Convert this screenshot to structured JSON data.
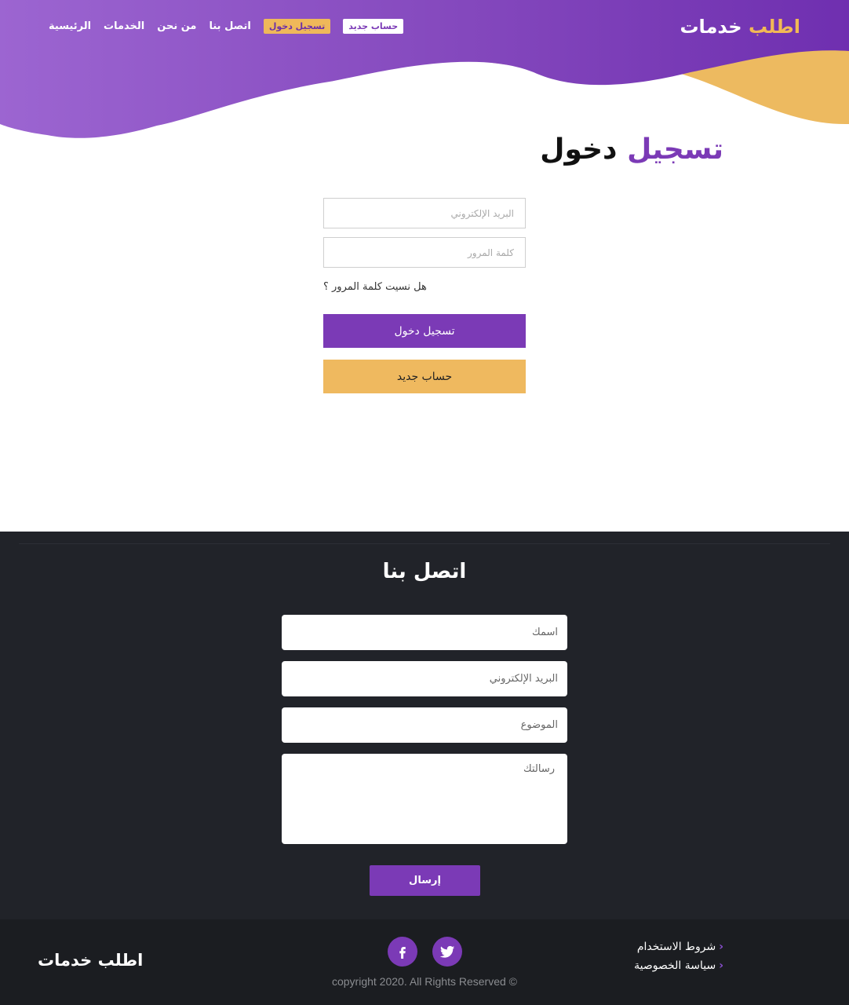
{
  "header": {
    "brand": {
      "part1": "اطلب",
      "part2": "خدمات"
    },
    "nav": {
      "home": "الرئيسية",
      "services": "الخدمات",
      "about": "من نحن",
      "contact": "اتصل بنا",
      "login": "تسجيل دخول",
      "register": "حساب جديد"
    }
  },
  "login": {
    "title_accent": "تسجيل",
    "title_rest": "دخول",
    "email_placeholder": "البريد الإلكتروني",
    "password_placeholder": "كلمة المرور",
    "forgot": "هل نسيت كلمة المرور ؟",
    "submit": "تسجيل دخول",
    "register": "حساب جديد"
  },
  "contact": {
    "title": "اتصل بنا",
    "name_placeholder": "اسمك",
    "email_placeholder": "البريد الإلكتروني",
    "subject_placeholder": "الموضوع",
    "message_placeholder": "رسالتك",
    "send": "إرسال"
  },
  "footer": {
    "brand": "اطلب خدمات",
    "copyright": "© copyright 2020. All Rights Reserved",
    "links": [
      "شروط الاستخدام",
      "سياسة الخصوصية"
    ],
    "social": [
      "facebook-icon",
      "twitter-icon"
    ]
  },
  "colors": {
    "purple": "#7b3ab6",
    "gold": "#efb95f",
    "dark": "#212329",
    "footer": "#1b1d21"
  }
}
